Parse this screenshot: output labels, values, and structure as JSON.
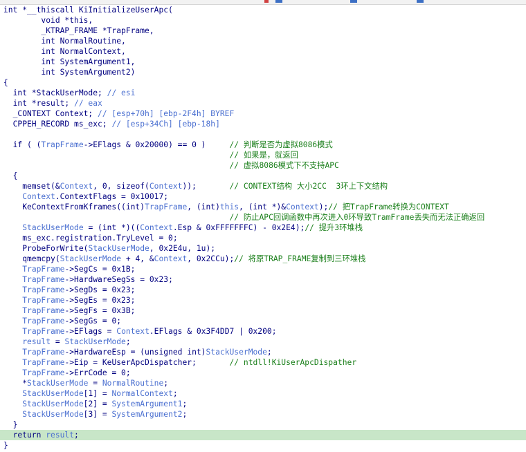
{
  "window": {
    "tab_marks": [
      {
        "color": "#d04040"
      },
      {
        "color": "#3c6fc4"
      },
      {
        "color": "#3c6fc4"
      },
      {
        "color": "#3c6fc4"
      }
    ]
  },
  "colors": {
    "keyword": "#000080",
    "variable": "#4a6fd0",
    "comment": "#1a7f1a",
    "highlight": "#c8e6c8"
  },
  "code": {
    "highlighted_line": 41,
    "lines": [
      [
        [
          "int *__thiscall KiInitializeUserApc(",
          "t"
        ]
      ],
      [
        [
          "        void *this,",
          "t"
        ]
      ],
      [
        [
          "        _KTRAP_FRAME *TrapFrame,",
          "t"
        ]
      ],
      [
        [
          "        int NormalRoutine,",
          "t"
        ]
      ],
      [
        [
          "        int NormalContext,",
          "t"
        ]
      ],
      [
        [
          "        int SystemArgument1,",
          "t"
        ]
      ],
      [
        [
          "        int SystemArgument2)",
          "t"
        ]
      ],
      [
        [
          "{",
          "p"
        ]
      ],
      [
        [
          "  int *StackUserMode; ",
          "t"
        ],
        [
          "// esi",
          "v"
        ]
      ],
      [
        [
          "  int *result; ",
          "t"
        ],
        [
          "// eax",
          "v"
        ]
      ],
      [
        [
          "  _CONTEXT Context; ",
          "t"
        ],
        [
          "// [esp+70h] [ebp-2F4h] BYREF",
          "v"
        ]
      ],
      [
        [
          "  CPPEH_RECORD ms_exc; ",
          "t"
        ],
        [
          "// [esp+34Ch] [ebp-18h]",
          "v"
        ]
      ],
      [
        [
          "",
          "t"
        ]
      ],
      [
        [
          "  if ( (",
          "t"
        ],
        [
          "TrapFrame",
          "v"
        ],
        [
          "->EFlags & 0x20000) == 0 )     ",
          "t"
        ],
        [
          "// 判断是否为虚拟8086模式",
          "c"
        ]
      ],
      [
        [
          "                                                // 如果是，就返回",
          "c"
        ]
      ],
      [
        [
          "                                                // 虚拟8086模式下不支持APC",
          "c"
        ]
      ],
      [
        [
          "  {",
          "p"
        ]
      ],
      [
        [
          "    memset(&",
          "t"
        ],
        [
          "Context",
          "v"
        ],
        [
          ", 0, sizeof(",
          "t"
        ],
        [
          "Context",
          "v"
        ],
        [
          "));       ",
          "t"
        ],
        [
          "// CONTEXT结构 大小2CC  3环上下文结构",
          "c"
        ]
      ],
      [
        [
          "    ",
          "t"
        ],
        [
          "Context",
          "v"
        ],
        [
          ".ContextFlags = 0x10017;",
          "t"
        ]
      ],
      [
        [
          "    KeContextFromKframes((int)",
          "t"
        ],
        [
          "TrapFrame",
          "v"
        ],
        [
          ", (int)",
          "t"
        ],
        [
          "this",
          "v"
        ],
        [
          ", (int *)&",
          "t"
        ],
        [
          "Context",
          "v"
        ],
        [
          ");",
          "t"
        ],
        [
          "// 把TrapFrame转换为CONTEXT",
          "c"
        ]
      ],
      [
        [
          "                                                // 防止APC回调函数中再次进入0环导致TramFrame丢失而无法正确返回",
          "c"
        ]
      ],
      [
        [
          "    ",
          "t"
        ],
        [
          "StackUserMode",
          "v"
        ],
        [
          " = (int *)((",
          "t"
        ],
        [
          "Context",
          "v"
        ],
        [
          ".Esp & 0xFFFFFFFC) - 0x2E4);",
          "t"
        ],
        [
          "// 提升3环堆栈",
          "c"
        ]
      ],
      [
        [
          "    ms_exc.registration.TryLevel = 0;",
          "t"
        ]
      ],
      [
        [
          "    ProbeForWrite(",
          "t"
        ],
        [
          "StackUserMode",
          "v"
        ],
        [
          ", 0x2E4u, 1u);",
          "t"
        ]
      ],
      [
        [
          "    qmemcpy(",
          "t"
        ],
        [
          "StackUserMode",
          "v"
        ],
        [
          " + 4, &",
          "t"
        ],
        [
          "Context",
          "v"
        ],
        [
          ", 0x2CCu);",
          "t"
        ],
        [
          "// 将原TRAP_FRAME复制到三环堆栈",
          "c"
        ]
      ],
      [
        [
          "    ",
          "t"
        ],
        [
          "TrapFrame",
          "v"
        ],
        [
          "->SegCs = 0x1B;",
          "t"
        ]
      ],
      [
        [
          "    ",
          "t"
        ],
        [
          "TrapFrame",
          "v"
        ],
        [
          "->HardwareSegSs = 0x23;",
          "t"
        ]
      ],
      [
        [
          "    ",
          "t"
        ],
        [
          "TrapFrame",
          "v"
        ],
        [
          "->SegDs = 0x23;",
          "t"
        ]
      ],
      [
        [
          "    ",
          "t"
        ],
        [
          "TrapFrame",
          "v"
        ],
        [
          "->SegEs = 0x23;",
          "t"
        ]
      ],
      [
        [
          "    ",
          "t"
        ],
        [
          "TrapFrame",
          "v"
        ],
        [
          "->SegFs = 0x3B;",
          "t"
        ]
      ],
      [
        [
          "    ",
          "t"
        ],
        [
          "TrapFrame",
          "v"
        ],
        [
          "->SegGs = 0;",
          "t"
        ]
      ],
      [
        [
          "    ",
          "t"
        ],
        [
          "TrapFrame",
          "v"
        ],
        [
          "->EFlags = ",
          "t"
        ],
        [
          "Context",
          "v"
        ],
        [
          ".EFlags & 0x3F4DD7 | 0x200;",
          "t"
        ]
      ],
      [
        [
          "    ",
          "t"
        ],
        [
          "result",
          "v"
        ],
        [
          " = ",
          "t"
        ],
        [
          "StackUserMode",
          "v"
        ],
        [
          ";",
          "t"
        ]
      ],
      [
        [
          "    ",
          "t"
        ],
        [
          "TrapFrame",
          "v"
        ],
        [
          "->HardwareEsp = (unsigned int)",
          "t"
        ],
        [
          "StackUserMode",
          "v"
        ],
        [
          ";",
          "t"
        ]
      ],
      [
        [
          "    ",
          "t"
        ],
        [
          "TrapFrame",
          "v"
        ],
        [
          "->Eip = KeUserApcDispatcher;       ",
          "t"
        ],
        [
          "// ntdll!KiUserApcDispather",
          "c"
        ]
      ],
      [
        [
          "    ",
          "t"
        ],
        [
          "TrapFrame",
          "v"
        ],
        [
          "->ErrCode = 0;",
          "t"
        ]
      ],
      [
        [
          "    *",
          "t"
        ],
        [
          "StackUserMode",
          "v"
        ],
        [
          " = ",
          "t"
        ],
        [
          "NormalRoutine",
          "v"
        ],
        [
          ";",
          "t"
        ]
      ],
      [
        [
          "    ",
          "t"
        ],
        [
          "StackUserMode",
          "v"
        ],
        [
          "[1] = ",
          "t"
        ],
        [
          "NormalContext",
          "v"
        ],
        [
          ";",
          "t"
        ]
      ],
      [
        [
          "    ",
          "t"
        ],
        [
          "StackUserMode",
          "v"
        ],
        [
          "[2] = ",
          "t"
        ],
        [
          "SystemArgument1",
          "v"
        ],
        [
          ";",
          "t"
        ]
      ],
      [
        [
          "    ",
          "t"
        ],
        [
          "StackUserMode",
          "v"
        ],
        [
          "[3] = ",
          "t"
        ],
        [
          "SystemArgument2",
          "v"
        ],
        [
          ";",
          "t"
        ]
      ],
      [
        [
          "  }",
          "p"
        ]
      ],
      [
        [
          "  return ",
          "t"
        ],
        [
          "result",
          "v"
        ],
        [
          ";",
          "t"
        ]
      ],
      [
        [
          "}",
          "p"
        ]
      ]
    ]
  }
}
